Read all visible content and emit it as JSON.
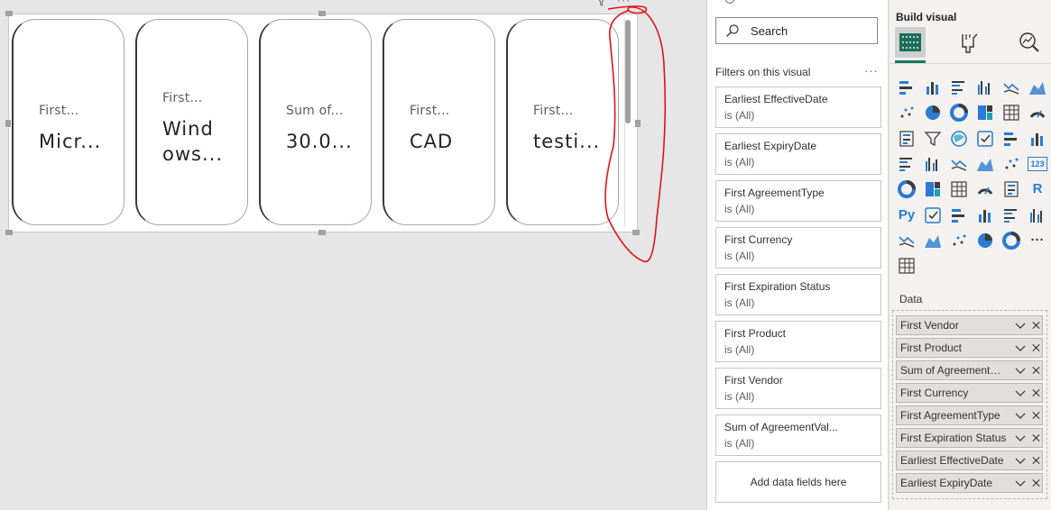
{
  "cards": [
    {
      "label": "First...",
      "value": "Micr..."
    },
    {
      "label": "First...",
      "value": "Wind ows..."
    },
    {
      "label": "Sum of...",
      "value": "30.0..."
    },
    {
      "label": "First...",
      "value": "CAD"
    },
    {
      "label": "First...",
      "value": "testi..."
    }
  ],
  "visual_header": {
    "more": "···"
  },
  "filters_pane": {
    "search_placeholder": "Search",
    "heading": "Filters on this visual",
    "more": "···",
    "filters": [
      {
        "title": "Earliest EffectiveDate",
        "state": "is (All)"
      },
      {
        "title": "Earliest ExpiryDate",
        "state": "is (All)"
      },
      {
        "title": "First AgreementType",
        "state": "is (All)"
      },
      {
        "title": "First Currency",
        "state": "is (All)"
      },
      {
        "title": "First Expiration Status",
        "state": "is (All)"
      },
      {
        "title": "First Product",
        "state": "is (All)"
      },
      {
        "title": "First Vendor",
        "state": "is (All)"
      },
      {
        "title": "Sum of AgreementVal...",
        "state": "is (All)"
      }
    ],
    "add_fields": "Add data fields here"
  },
  "viz_pane": {
    "title": "Build visual",
    "modes": [
      "build-visual",
      "format-visual",
      "analytics"
    ],
    "icons": [
      "stacked-bar-icon",
      "stacked-column-icon",
      "clustered-bar-icon",
      "clustered-column-icon",
      "100-stacked-bar-icon",
      "100-stacked-column-icon",
      "line-chart-icon",
      "area-chart-icon",
      "stacked-area-icon",
      "line-and-column-icon",
      "line-clustered-column-icon",
      "ribbon-chart-icon",
      "waterfall-icon",
      "funnel-icon",
      "scatter-icon",
      "pie-chart-icon",
      "donut-chart-icon",
      "treemap-icon",
      "map-icon",
      "filled-map-icon",
      "shape-map-icon",
      "azure-map-icon",
      "gauge-icon",
      "card-icon",
      "multi-row-card-icon",
      "kpi-icon",
      "slicer-icon",
      "table-icon",
      "matrix-icon",
      "r-visual-icon",
      "python-visual-icon",
      "key-influencers-icon",
      "decomposition-tree-icon",
      "qa-icon",
      "smart-narrative-icon",
      "metrics-icon",
      "paginated-report-icon",
      "new-card-icon",
      "arcgis-icon",
      "power-apps-icon",
      "power-automate-icon",
      "more-visuals-icon",
      "get-more-visuals-icon"
    ],
    "icon_glyphs": {
      "card-icon": "123",
      "r-visual-icon": "R",
      "python-visual-icon": "Py",
      "more-visuals-icon": "···"
    },
    "data_label": "Data",
    "fields": [
      "First Vendor",
      "First Product",
      "Sum of AgreementVal...",
      "First Currency",
      "First AgreementType",
      "First Expiration Status",
      "Earliest EffectiveDate",
      "Earliest ExpiryDate"
    ]
  },
  "colors": {
    "accent": "#117865",
    "icon_blue": "#2b7bd0",
    "annotation": "#e0141b"
  }
}
